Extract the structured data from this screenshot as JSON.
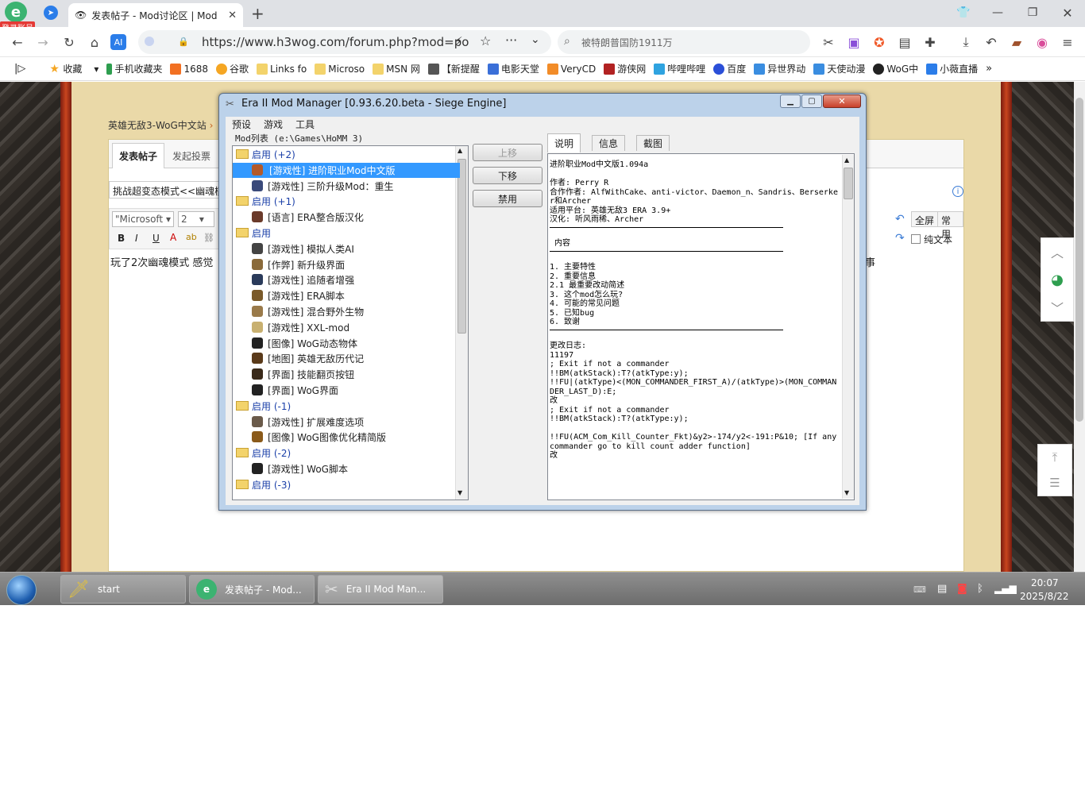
{
  "browser": {
    "login_badge": "登录账号",
    "tab_title": "发表帖子 - Mod讨论区 | Mod",
    "url": "https://www.h3wog.com/forum.php?mod=po",
    "search_text": "被特朗普国防1911万",
    "bookmarks": [
      "收藏",
      "手机收藏夹",
      "1688",
      "谷歌",
      "Links fo",
      "Microso",
      "MSN 网",
      "【新提醒",
      "电影天堂",
      "VeryCD",
      "游侠网",
      "哔哩哔哩",
      "百度",
      "异世界动",
      "天使动漫",
      "WoG中",
      "小薇直播"
    ]
  },
  "page": {
    "breadcrumb": "英雄无敌3-WoG中文站",
    "post_tab": "发表帖子",
    "vote_tab": "发起投票",
    "subject_value": "挑战超变态模式<<幽魂模",
    "font_select": "\"Microsoft",
    "size_select": "2",
    "body_text": "玩了2次幽魂模式 感觉",
    "body_tail": "事",
    "fullscreen_label": "全屏",
    "common_label": "常用",
    "plaintext_label": "纯文本"
  },
  "dialog": {
    "title": "Era II Mod Manager [0.93.6.20.beta - Siege Engine]",
    "menu": [
      "预设",
      "游戏",
      "工具"
    ],
    "list_label": "Mod列表 (e:\\Games\\HoMM 3)",
    "tree": [
      {
        "type": "group",
        "label": "启用 (+2)"
      },
      {
        "type": "mod",
        "label": "[游戏性] 进阶职业Mod中文版",
        "selected": true,
        "color": "#b35a2a"
      },
      {
        "type": "mod",
        "label": "[游戏性] 三阶升级Mod：重生",
        "color": "#3a4a7a"
      },
      {
        "type": "group",
        "label": "启用 (+1)"
      },
      {
        "type": "mod",
        "label": "[语言] ERA整合版汉化",
        "color": "#6a3a2a"
      },
      {
        "type": "group",
        "label": "启用"
      },
      {
        "type": "mod",
        "label": "[游戏性] 模拟人类AI",
        "color": "#444"
      },
      {
        "type": "mod",
        "label": "[作弊] 新升级界面",
        "color": "#8a6a3a"
      },
      {
        "type": "mod",
        "label": "[游戏性] 追随者增强",
        "color": "#2a3a5a"
      },
      {
        "type": "mod",
        "label": "[游戏性] ERA脚本",
        "color": "#7a5a2a"
      },
      {
        "type": "mod",
        "label": "[游戏性] 混合野外生物",
        "color": "#9a7a4a"
      },
      {
        "type": "mod",
        "label": "[游戏性] XXL-mod",
        "color": "#c8b070"
      },
      {
        "type": "mod",
        "label": "[图像] WoG动态物体",
        "color": "#222"
      },
      {
        "type": "mod",
        "label": "[地图] 英雄无敌历代记",
        "color": "#5a3a1a"
      },
      {
        "type": "mod",
        "label": "[界面] 技能翻页按钮",
        "color": "#3a2a1a"
      },
      {
        "type": "mod",
        "label": "[界面] WoG界面",
        "color": "#222"
      },
      {
        "type": "group",
        "label": "启用 (-1)"
      },
      {
        "type": "mod",
        "label": "[游戏性] 扩展难度选项",
        "color": "#6a5a4a"
      },
      {
        "type": "mod",
        "label": "[图像] WoG图像优化精简版",
        "color": "#8a5a1a"
      },
      {
        "type": "group",
        "label": "启用 (-2)"
      },
      {
        "type": "mod",
        "label": "[游戏性] WoG脚本",
        "color": "#222"
      },
      {
        "type": "group",
        "label": "启用 (-3)"
      }
    ],
    "buttons": {
      "up": "上移",
      "down": "下移",
      "disable": "禁用"
    },
    "tabs": [
      "说明",
      "信息",
      "截图"
    ],
    "desc_title": "进阶职业Mod中文版1.094a",
    "desc_author": "作者: Perry R",
    "desc_coauthors": "合作作者: AlfWithCake、anti-victor、Daemon_n、Sandris、Berserker和Archer",
    "desc_platform": "适用平台: 英雄无敌3 ERA 3.9+",
    "desc_translate": "汉化: 听风雨稀、Archer",
    "desc_contents_head": "内容",
    "desc_contents": [
      "1. 主要特性",
      "2. 重要信息",
      "2.1 最重要改动简述",
      "3. 这个mod怎么玩?",
      "4. 可能的常见问题",
      "5. 已知bug",
      "6. 致谢"
    ],
    "desc_changelog_head": "更改日志:",
    "desc_log": [
      "11197",
      "; Exit if not a commander",
      "!!BM(atkStack):T?(atkType:y);",
      "!!FU|(atkType)<(MON_COMMANDER_FIRST_A)/(atkType)>(MON_COMMANDER_LAST_D):E;",
      "改",
      "; Exit if not a commander",
      "!!BM(atkStack):T?(atkType:y);",
      "",
      "!!FU(ACM_Com_Kill_Counter_Fkt)&y2>-174/y2<-191:P&10; [If any commander go to kill count adder function]",
      "改"
    ]
  },
  "taskbar": {
    "start_label": "start",
    "items": [
      "发表帖子 - Mod...",
      "Era II Mod Man..."
    ],
    "time": "20:07",
    "date": "2025/8/22"
  }
}
